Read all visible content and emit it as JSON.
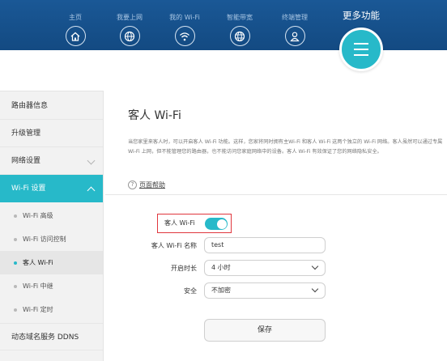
{
  "nav": {
    "items": [
      {
        "label": "主页",
        "icon": "home-icon"
      },
      {
        "label": "我要上网",
        "icon": "globe-icon"
      },
      {
        "label": "我的 Wi-Fi",
        "icon": "wifi-icon"
      },
      {
        "label": "智能带宽",
        "icon": "bandwidth-globe-icon"
      },
      {
        "label": "终端管理",
        "icon": "user-icon"
      }
    ],
    "more_label": "更多功能"
  },
  "sidebar": {
    "items": [
      {
        "label": "路由器信息"
      },
      {
        "label": "升级管理"
      },
      {
        "label": "网络设置"
      },
      {
        "label": "Wi-Fi 设置"
      },
      {
        "label": "Wi-Fi 高级"
      },
      {
        "label": "Wi-Fi 访问控制"
      },
      {
        "label": "客人 Wi-Fi"
      },
      {
        "label": "Wi-Fi 中继"
      },
      {
        "label": "Wi-Fi 定时"
      },
      {
        "label": "动态域名服务 DDNS"
      }
    ]
  },
  "main": {
    "title": "客人 Wi-Fi",
    "description": "当您家里来客人时，可以开启客人 Wi-Fi 功能。这样，您家将同时拥有主Wi-Fi 和客人 Wi-Fi 这两个独立的 Wi-Fi 网络。客人虽然可以通过专属 Wi-Fi 上网，但不能管理您的路由器，也不能访问您家庭网络中的设备。客人 Wi-Fi 有效保证了您的网络隐私安全。",
    "help_label": "页面帮助",
    "guest_wifi_label": "客人 Wi-Fi",
    "guest_wifi_enabled": true,
    "name_label": "客人 Wi-Fi 名称",
    "name_value": "test",
    "duration_label": "开启时长",
    "duration_value": "4 小时",
    "security_label": "安全",
    "security_value": "不加密",
    "save_label": "保存"
  },
  "colors": {
    "header": "#1a5896",
    "accent": "#27b9c9",
    "highlight_border": "#e0363d"
  }
}
